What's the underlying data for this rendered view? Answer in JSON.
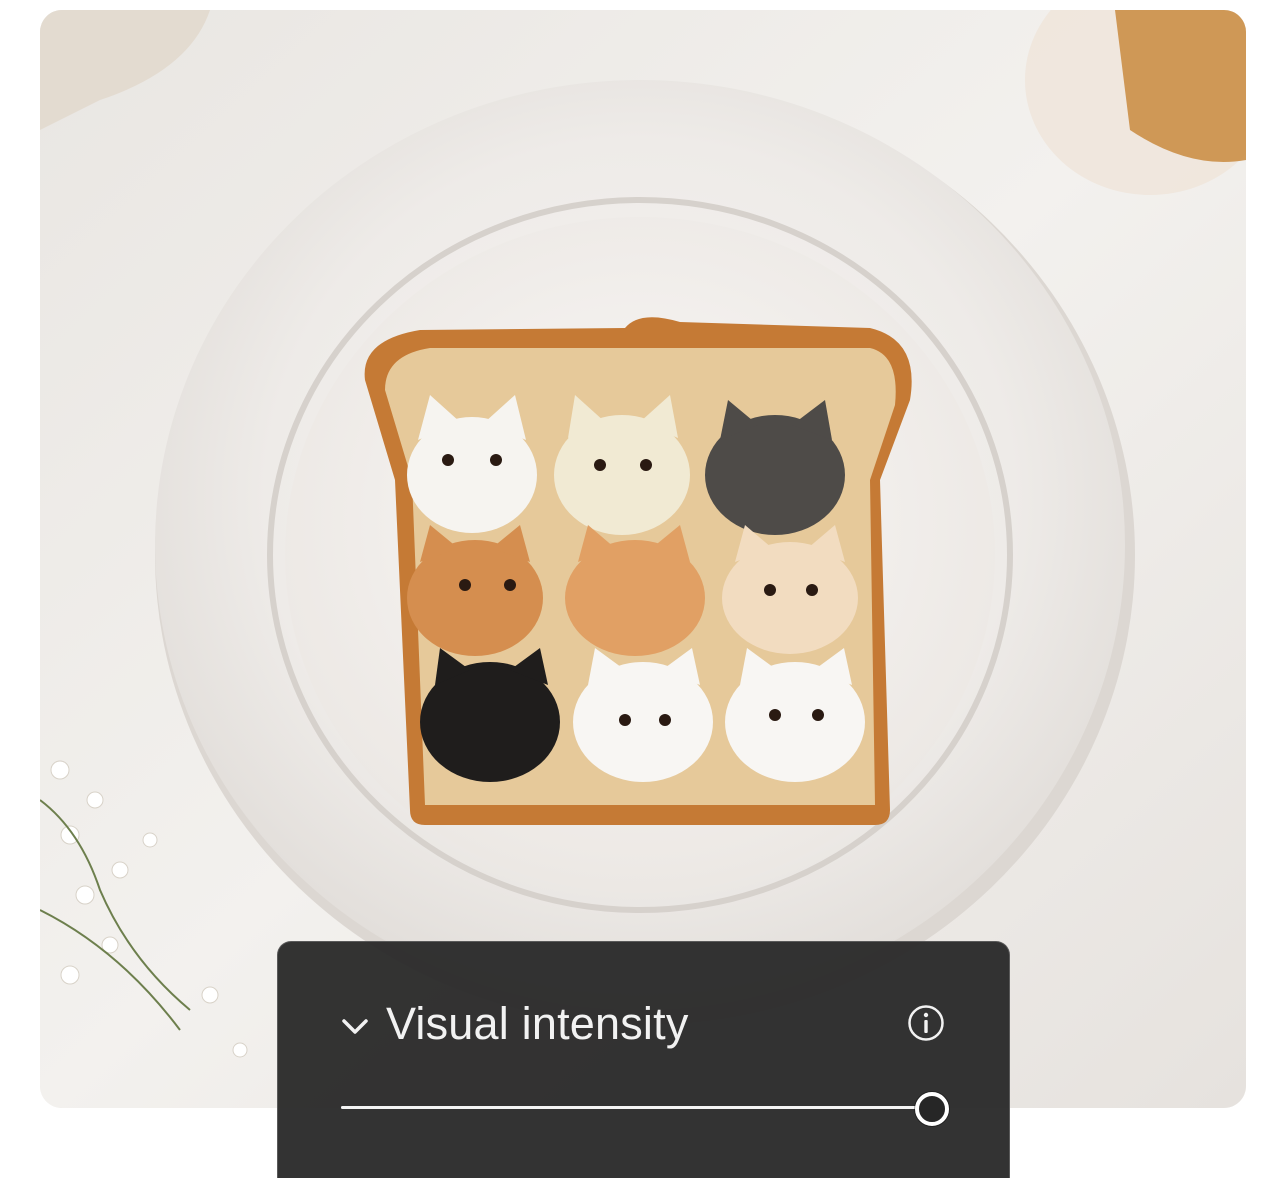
{
  "panel": {
    "title": "Visual intensity",
    "expand_icon": "chevron-down-icon",
    "info_icon": "info-icon",
    "slider_value": 1.0
  },
  "colors": {
    "panel_bg": "#282828",
    "track": "#7a7a7a",
    "fill": "#f4f4f4"
  }
}
